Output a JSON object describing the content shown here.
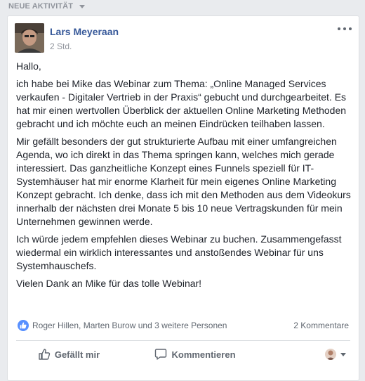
{
  "section": {
    "title": "NEUE AKTIVITÄT"
  },
  "post": {
    "author": "Lars Meyeraan",
    "timestamp": "2 Std.",
    "paragraphs": [
      "Hallo,",
      "ich habe bei Mike das Webinar zum Thema: „Online Managed Services verkaufen - Digitaler Vertrieb in der Praxis“ gebucht und durchgearbeitet. Es hat mir einen wertvollen Überblick der aktuellen Online Marketing Methoden gebracht und ich möchte euch an meinen Eindrücken teilhaben lassen.",
      "Mir gefällt besonders der gut strukturierte Aufbau mit einer umfangreichen Agenda, wo ich direkt in das Thema springen kann, welches mich gerade interessiert. Das ganzheitliche Konzept eines Funnels speziell für IT-Systemhäuser hat mir enorme Klarheit für mein eigenes Online Marketing Konzept gebracht. Ich denke, dass ich mit den Methoden aus dem Videokurs innerhalb der nächsten drei Monate 5 bis 10 neue Vertragskunden für mein Unternehmen gewinnen werde.",
      "Ich würde jedem empfehlen dieses Webinar zu buchen. Zusammengefasst wiedermal ein wirklich interessantes und anstoßendes Webinar für uns Systemhauschefs.",
      "Vielen Dank an Mike für das tolle Webinar!"
    ],
    "reactions": "Roger Hillen, Marten Burow und 3 weitere Personen",
    "comments_count": "2 Kommentare",
    "actions": {
      "like": "Gefällt mir",
      "comment": "Kommentieren"
    }
  },
  "colors": {
    "link": "#365899",
    "like_blue": "#5890ff",
    "muted": "#90949c"
  }
}
